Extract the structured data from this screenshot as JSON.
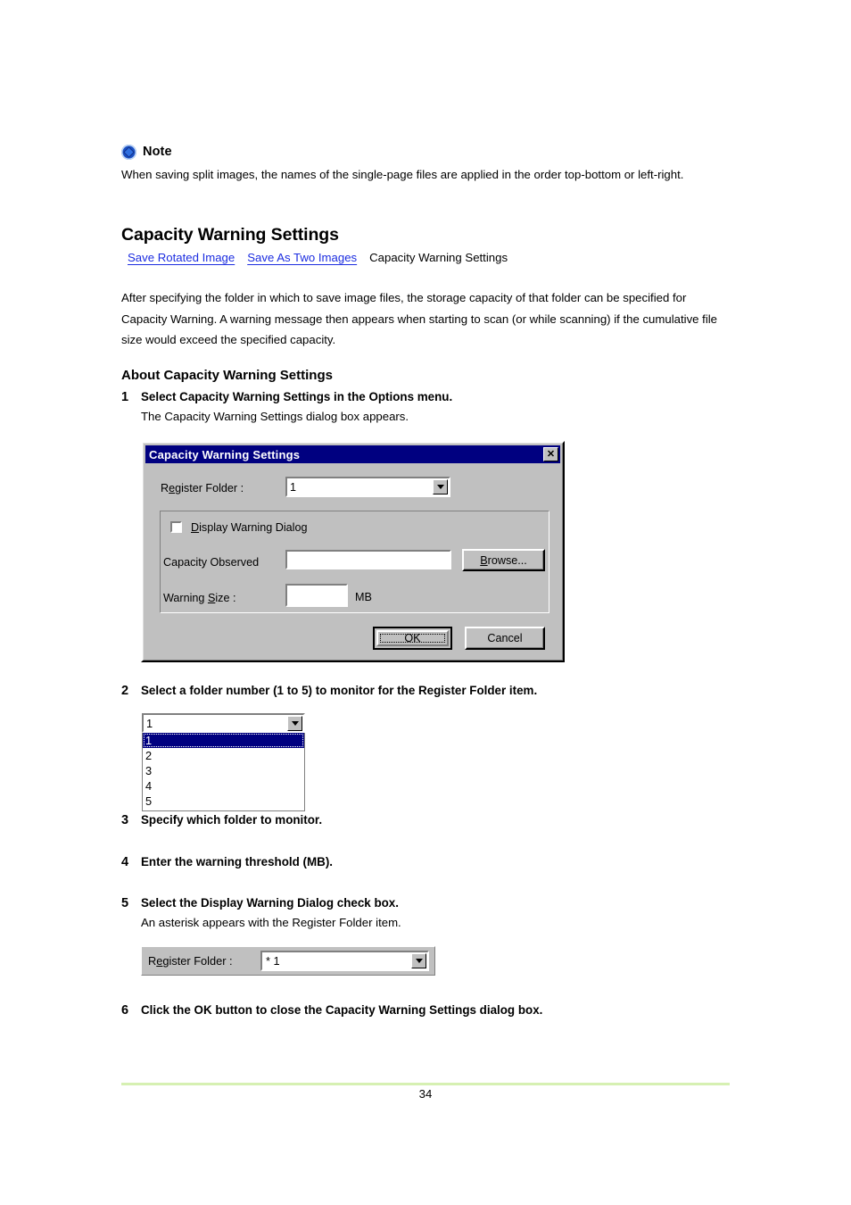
{
  "note": {
    "icon": "note-diamond-icon",
    "title": "Note",
    "body": "When saving split images, the names of the single-page files are applied in the order top-bottom or left-right."
  },
  "heading": "Capacity Warning Settings",
  "breadcrumb": {
    "link1": "Save Rotated Image",
    "link2": "Save As Two Images",
    "current": "Capacity Warning Settings",
    "link_color": "#1b2ce0"
  },
  "intro": "After specifying the folder in which to save image files, the storage capacity of that folder can be specified for Capacity Warning. A warning message then appears when starting to scan (or while scanning) if the cumulative file size would exceed the specified capacity.",
  "subheading": "About Capacity Warning Settings",
  "steps": [
    {
      "num": "1",
      "title": "Select Capacity Warning Settings in the Options menu.",
      "sub": "The Capacity Warning Settings dialog box appears."
    },
    {
      "num": "2",
      "title": "Select a folder number (1 to 5) to monitor for the Register Folder item.",
      "sub": ""
    },
    {
      "num": "3",
      "title": "Specify which folder to monitor.",
      "sub": ""
    },
    {
      "num": "4",
      "title": "Enter the warning threshold (MB).",
      "sub": ""
    },
    {
      "num": "5",
      "title": "Select the Display Warning Dialog check box.",
      "sub": "An asterisk appears with the Register Folder item."
    },
    {
      "num": "6",
      "title": "Click the OK button to close the Capacity Warning Settings dialog box.",
      "sub": ""
    }
  ],
  "dialog": {
    "title": "Capacity Warning Settings",
    "close_label": "✕",
    "titlebar_color": "#000080",
    "face_color": "#c0c0c0",
    "register_folder_label_pre": "R",
    "register_folder_label_acc": "e",
    "register_folder_label_post": "gister Folder :",
    "register_folder_value": "1",
    "checkbox_label_pre": "",
    "checkbox_label_acc": "D",
    "checkbox_label_mid": "isplay Warnin",
    "checkbox_label_acc2": "g",
    "checkbox_label_post": " Dialog",
    "checkbox_checked": false,
    "capacity_observed_label": "Capacity Observed",
    "capacity_observed_value": "",
    "browse_label_acc": "B",
    "browse_label_post": "rowse...",
    "warning_size_label_pre": "Warning ",
    "warning_size_label_acc": "S",
    "warning_size_label_post": "ize :",
    "warning_size_value": "",
    "warning_size_unit": "MB",
    "ok_label": "OK",
    "cancel_label": "Cancel"
  },
  "dropdown": {
    "selected_value": "1",
    "options": [
      "1",
      "2",
      "3",
      "4",
      "5"
    ],
    "highlight_color": "#000080"
  },
  "register_folder_widget": {
    "label_pre": "R",
    "label_acc": "e",
    "label_post": "gister Folder :",
    "value": "* 1"
  },
  "footer": {
    "page_number": "34",
    "rule_color": "#d6f0b2"
  }
}
